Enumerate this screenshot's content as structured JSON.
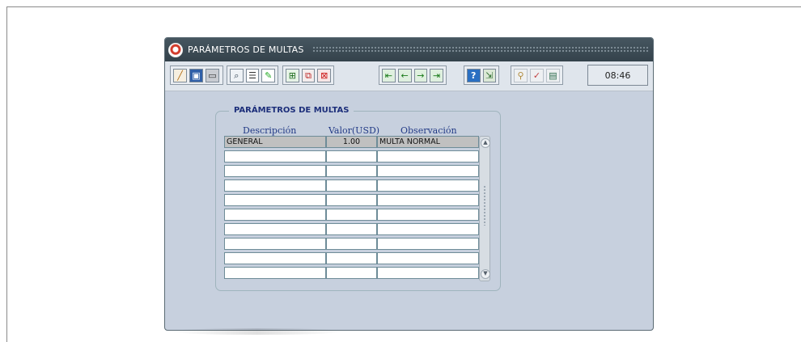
{
  "window": {
    "title": "PARÁMETROS DE MULTAS"
  },
  "toolbar": {
    "time": "08:46",
    "icons": [
      "broom-icon",
      "save-icon",
      "print-icon",
      "search-icon",
      "list-icon",
      "edit-icon",
      "insert-record-icon",
      "duplicate-record-icon",
      "delete-record-icon",
      "first-record-icon",
      "previous-record-icon",
      "next-record-icon",
      "last-record-icon",
      "help-icon",
      "exit-icon",
      "tool-a-icon",
      "tool-b-icon",
      "calendar-icon"
    ]
  },
  "section": {
    "legend": "PARÁMETROS DE MULTAS",
    "columns": {
      "description": "Descripción",
      "value": "Valor(USD)",
      "observation": "Observación"
    },
    "rows": [
      {
        "description": "GENERAL",
        "value": "1.00",
        "observation": "MULTA NORMAL"
      },
      {
        "description": "",
        "value": "",
        "observation": ""
      },
      {
        "description": "",
        "value": "",
        "observation": ""
      },
      {
        "description": "",
        "value": "",
        "observation": ""
      },
      {
        "description": "",
        "value": "",
        "observation": ""
      },
      {
        "description": "",
        "value": "",
        "observation": ""
      },
      {
        "description": "",
        "value": "",
        "observation": ""
      },
      {
        "description": "",
        "value": "",
        "observation": ""
      },
      {
        "description": "",
        "value": "",
        "observation": ""
      },
      {
        "description": "",
        "value": "",
        "observation": ""
      }
    ]
  },
  "colors": {
    "titlebar": "#3c4a53",
    "window_bg": "#c7d0de",
    "legend_text": "#1c2e7a",
    "selected_row": "#c0c0c0"
  }
}
